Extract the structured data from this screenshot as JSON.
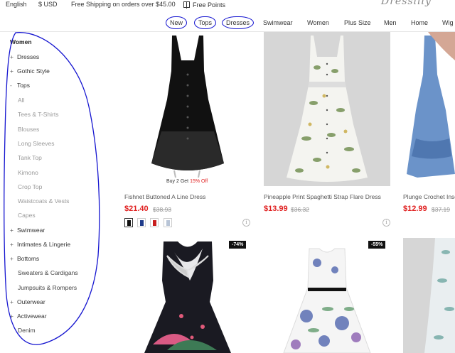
{
  "topbar": {
    "language": "English",
    "currency": "$ USD",
    "shipping": "Free Shipping on orders over $45.00",
    "points": "Free Points",
    "logo": "Dresslily"
  },
  "nav": {
    "items": [
      "New",
      "Tops",
      "Dresses",
      "Swimwear",
      "Women",
      "Plus Size",
      "Men",
      "Home",
      "Wig"
    ]
  },
  "sidebar": {
    "title": "Women",
    "items": [
      {
        "sign": "+",
        "label": "Dresses"
      },
      {
        "sign": "+",
        "label": "Gothic Style"
      },
      {
        "sign": "-",
        "label": "Tops"
      }
    ],
    "tops_sub": [
      "All",
      "Tees & T-Shirts",
      "Blouses",
      "Long Sleeves",
      "Tank Top",
      "Kimono",
      "Crop Top",
      "Waistcoats & Vests",
      "Capes"
    ],
    "more": [
      {
        "sign": "+",
        "label": "Swimwear"
      },
      {
        "sign": "+",
        "label": "Intimates & Lingerie"
      },
      {
        "sign": "+",
        "label": "Bottoms"
      }
    ],
    "bottoms_sub": [
      "Sweaters & Cardigans",
      "Jumpsuits & Rompers"
    ],
    "more2": [
      {
        "sign": "+",
        "label": "Outerwear"
      },
      {
        "sign": "+",
        "label": "Activewear"
      }
    ],
    "last_sub": "Denim"
  },
  "products": [
    {
      "promo": "Buy 2 Get ",
      "promo_red": "15% Off",
      "name": "Fishnet Buttoned A Line Dress",
      "price": "$21.40",
      "original": "$38.93",
      "swatches": [
        "#111111",
        "#1e3a8a",
        "#c81e1e",
        "#b8c4d6"
      ]
    },
    {
      "name": "Pineapple Print Spaghetti Strap Flare Dress",
      "price": "$13.99",
      "original": "$36.32"
    },
    {
      "name": "Plunge Crochet Inse",
      "price": "$12.99",
      "original": "$37.19"
    }
  ],
  "bottom_badges": [
    "-74%",
    "-55%"
  ],
  "colors": {
    "sale": "#e02020",
    "annotation": "#1515d0"
  }
}
